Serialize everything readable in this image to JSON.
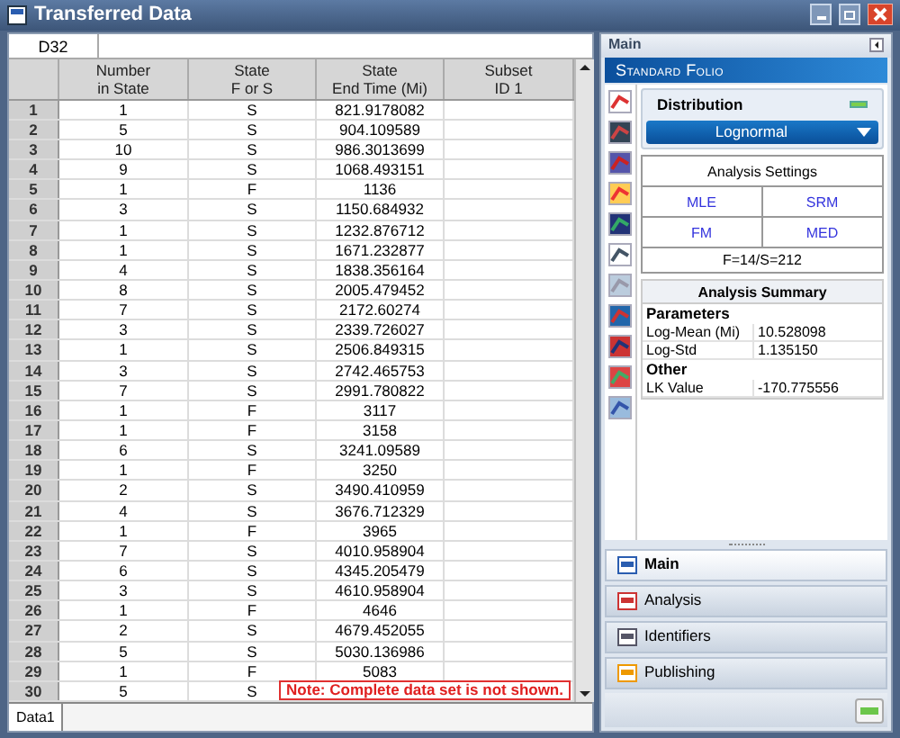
{
  "window": {
    "title": "Transferred Data"
  },
  "name_box": "D32",
  "table": {
    "columns": [
      "",
      "Number\nin State",
      "State\nF or S",
      "State\nEnd Time (Mi)",
      "Subset\nID 1"
    ],
    "rows": [
      [
        "1",
        "1",
        "S",
        "821.9178082"
      ],
      [
        "2",
        "5",
        "S",
        "904.109589"
      ],
      [
        "3",
        "10",
        "S",
        "986.3013699"
      ],
      [
        "4",
        "9",
        "S",
        "1068.493151"
      ],
      [
        "5",
        "1",
        "F",
        "1136"
      ],
      [
        "6",
        "3",
        "S",
        "1150.684932"
      ],
      [
        "7",
        "1",
        "S",
        "1232.876712"
      ],
      [
        "8",
        "1",
        "S",
        "1671.232877"
      ],
      [
        "9",
        "4",
        "S",
        "1838.356164"
      ],
      [
        "10",
        "8",
        "S",
        "2005.479452"
      ],
      [
        "11",
        "7",
        "S",
        "2172.60274"
      ],
      [
        "12",
        "3",
        "S",
        "2339.726027"
      ],
      [
        "13",
        "1",
        "S",
        "2506.849315"
      ],
      [
        "14",
        "3",
        "S",
        "2742.465753"
      ],
      [
        "15",
        "7",
        "S",
        "2991.780822"
      ],
      [
        "16",
        "1",
        "F",
        "3117"
      ],
      [
        "17",
        "1",
        "F",
        "3158"
      ],
      [
        "18",
        "6",
        "S",
        "3241.09589"
      ],
      [
        "19",
        "1",
        "F",
        "3250"
      ],
      [
        "20",
        "2",
        "S",
        "3490.410959"
      ],
      [
        "21",
        "4",
        "S",
        "3676.712329"
      ],
      [
        "22",
        "1",
        "F",
        "3965"
      ],
      [
        "23",
        "7",
        "S",
        "4010.958904"
      ],
      [
        "24",
        "6",
        "S",
        "4345.205479"
      ],
      [
        "25",
        "3",
        "S",
        "4610.958904"
      ],
      [
        "26",
        "1",
        "F",
        "4646"
      ],
      [
        "27",
        "2",
        "S",
        "4679.452055"
      ],
      [
        "28",
        "5",
        "S",
        "5030.136986"
      ],
      [
        "29",
        "1",
        "F",
        "5083"
      ],
      [
        "30",
        "5",
        "S"
      ]
    ]
  },
  "note": "Note: Complete data set is not shown.",
  "sheet_tabs": [
    {
      "label": "Data1",
      "selected": true
    }
  ],
  "panel": {
    "header": "Main",
    "banner": "Standard Folio",
    "distribution": {
      "title": "Distribution",
      "value": "Lognormal"
    },
    "analysis_settings": {
      "title": "Analysis Settings",
      "options": [
        "MLE",
        "SRM",
        "FM",
        "MED"
      ],
      "footer": "F=14/S=212"
    },
    "analysis_summary": {
      "title": "Analysis Summary",
      "sections": [
        {
          "heading": "Parameters",
          "rows": [
            [
              "Log-Mean (Mi)",
              "10.528098"
            ],
            [
              "Log-Std",
              "1.135150"
            ]
          ]
        },
        {
          "heading": "Other",
          "rows": [
            [
              "LK Value",
              "-170.775556"
            ]
          ]
        }
      ]
    },
    "nav": [
      {
        "label": "Main",
        "selected": true
      },
      {
        "label": "Analysis",
        "selected": false
      },
      {
        "label": "Identifiers",
        "selected": false
      },
      {
        "label": "Publishing",
        "selected": false
      }
    ]
  }
}
